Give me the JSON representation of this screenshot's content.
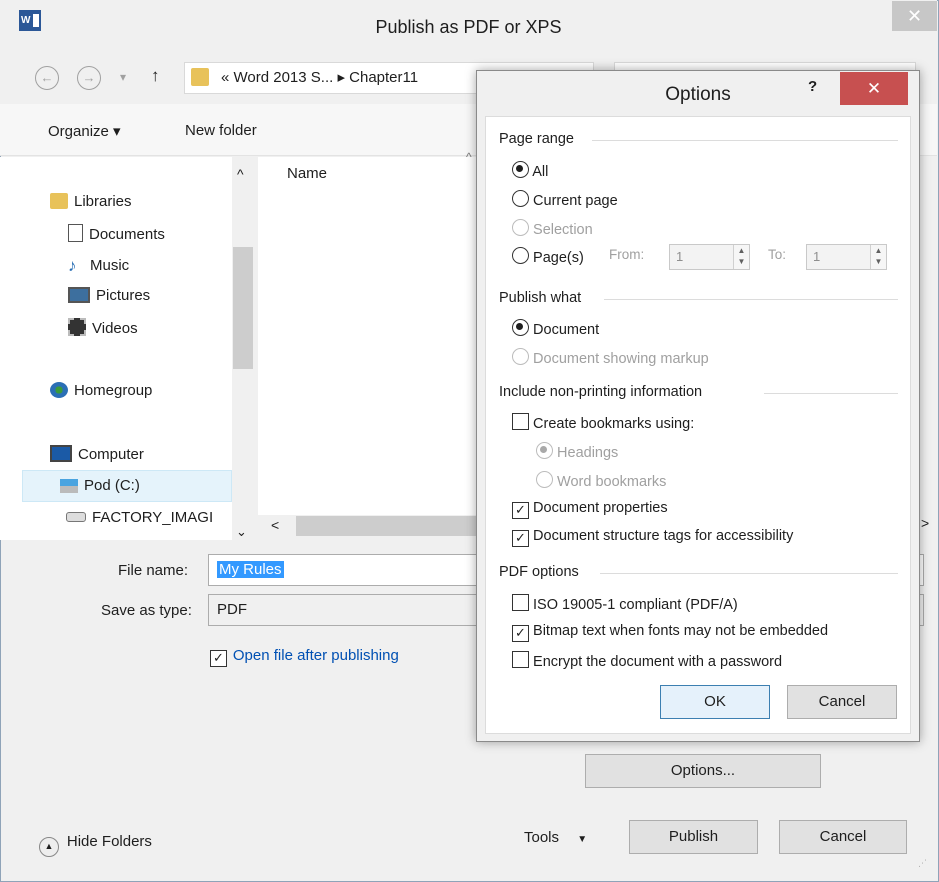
{
  "window": {
    "title": "Publish as PDF or XPS",
    "close_glyph": "✕",
    "app_icon": "word-icon",
    "app_icon_text": "W"
  },
  "nav": {
    "back_glyph": "←",
    "forward_glyph": "→",
    "dropdown_glyph": "▾",
    "up_glyph": "↑",
    "breadcrumb": "« Word 2013 S...  ▸  Chapter11"
  },
  "toolbar": {
    "organize_label": "Organize ▾",
    "new_folder_label": "New folder"
  },
  "sidebar": {
    "scroll_up_glyph": "^",
    "items": [
      {
        "label": "Libraries",
        "icon": "libraries-icon"
      },
      {
        "label": "Documents",
        "icon": "documents-icon"
      },
      {
        "label": "Music",
        "icon": "music-icon"
      },
      {
        "label": "Pictures",
        "icon": "pictures-icon"
      },
      {
        "label": "Videos",
        "icon": "videos-icon"
      },
      {
        "label": "Homegroup",
        "icon": "homegroup-icon"
      },
      {
        "label": "Computer",
        "icon": "computer-icon"
      },
      {
        "label": "Pod (C:)",
        "icon": "drive-icon"
      },
      {
        "label": "FACTORY_IMAGI",
        "icon": "drive-icon"
      }
    ],
    "scroll_down_glyph": "⌄"
  },
  "files": {
    "name_header": "Name",
    "sort_glyph": "^",
    "hscroll_left_glyph": "<",
    "hscroll_right_glyph": ">"
  },
  "form": {
    "file_name_label": "File name:",
    "file_name_value": "My Rules",
    "save_type_label": "Save as type:",
    "save_type_value": "PDF",
    "open_after_label": "Open file after publishing",
    "open_after_checked": true,
    "options_button": "Options...",
    "hide_folders": "Hide Folders",
    "tools": "Tools",
    "tools_caret": "▼",
    "publish": "Publish",
    "cancel": "Cancel",
    "checkmark": "✓"
  },
  "options": {
    "title": "Options",
    "help": "?",
    "close_glyph": "✕",
    "page_range": {
      "heading": "Page range",
      "all": "All",
      "current_page": "Current page",
      "selection": "Selection",
      "pages": "Page(s)",
      "from_label": "From:",
      "from_value": "1",
      "to_label": "To:",
      "to_value": "1",
      "spin_up": "▲",
      "spin_down": "▼",
      "selected": "All"
    },
    "publish_what": {
      "heading": "Publish what",
      "document": "Document",
      "document_markup": "Document showing markup",
      "selected": "Document"
    },
    "non_printing": {
      "heading": "Include non-printing information",
      "create_bookmarks": "Create bookmarks using:",
      "headings": "Headings",
      "word_bookmarks": "Word bookmarks",
      "doc_properties": "Document properties",
      "structure_tags": "Document structure tags for accessibility"
    },
    "pdf_options": {
      "heading": "PDF options",
      "iso": "ISO 19005-1 compliant (PDF/A)",
      "bitmap_text": "Bitmap text when fonts may not be embedded",
      "encrypt": "Encrypt the document with a password"
    },
    "ok": "OK",
    "cancel": "Cancel"
  }
}
